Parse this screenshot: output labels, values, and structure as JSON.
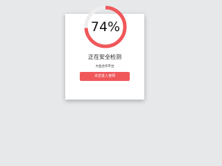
{
  "progress": {
    "percent_label": "74%",
    "value": 0.74
  },
  "status_text": "正在安全检测",
  "subtitle": "大鱼合作平台",
  "button_label": "点击进入官网",
  "colors": {
    "accent": "#f0575a",
    "track": "#eeeeee",
    "background": "#e6e8ea",
    "card": "#ffffff"
  }
}
